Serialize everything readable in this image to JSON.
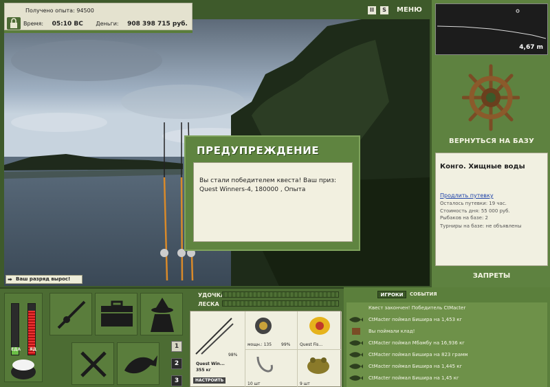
{
  "info": {
    "experience_label": "Получено опыта:",
    "experience_value": "94500",
    "time_label": "Время:",
    "time_value": "05:10 ВС",
    "money_label": "Деньги:",
    "money_value": "908 398 715 руб."
  },
  "topbar": {
    "pause": "II",
    "speed": "S",
    "menu": "МЕНЮ"
  },
  "depth": {
    "value": "4,67 m"
  },
  "base": {
    "return_label": "ВЕРНУТЬСЯ НА БАЗУ",
    "location": "Конго. Хищные воды",
    "extend_link": "Продлить путевку",
    "lines": [
      "Осталось путевки: 19 час.",
      "Стоимость дня: 55 000 руб.",
      "Рыбаков на базе: 2",
      "Турниры на базе: не объявлены"
    ],
    "bans_label": "ЗАПРЕТЫ"
  },
  "toast": "Ваш разряд вырос!",
  "modal": {
    "title": "ПРЕДУПРЕЖДЕНИЕ",
    "message": "Вы стали победителем квеста! Ваш приз: Quest Winners-4, 180000 , Опыта"
  },
  "meters": {
    "food_label": "ЕДА",
    "poison_label": "ЯД",
    "food_level": 0.15,
    "poison_level": 0.85
  },
  "hotbar": {
    "buttons": [
      "1",
      "2",
      "3"
    ],
    "selected": "2"
  },
  "tackle": {
    "rod_label": "УДОЧКА",
    "line_label": "ЛЕСКА",
    "rod_name": "Quest Win...",
    "rod_weight": "355 кг",
    "rod_percent": "98%",
    "reel_label": "мощн.: 135",
    "reel_percent": "99%",
    "lure_label": "Quest Fis...",
    "hook_count": "10 шт",
    "bait_count": "9 шт",
    "setup_label": "НАСТРОИТЬ"
  },
  "events": {
    "tabs": [
      "ИГРОКИ",
      "СОБЫТИЯ"
    ],
    "active_tab": "ИГРОКИ",
    "items": [
      {
        "icon": "none",
        "text": "Квест закончен! Победитель CtMacter"
      },
      {
        "icon": "fish",
        "text": "CtMacter поймал Бишира на 1,453 кг"
      },
      {
        "icon": "chest",
        "text": "Вы поймали клад!"
      },
      {
        "icon": "fish",
        "text": "CtMacter поймал Мбамбу на 16,936 кг"
      },
      {
        "icon": "fish",
        "text": "CtMacter поймал Бишира на 823 грамм"
      },
      {
        "icon": "fish",
        "text": "CtMacter поймал Бишира на 1,445 кг"
      },
      {
        "icon": "fish",
        "text": "CtMacter поймал Бишира на 1,45 кг"
      }
    ]
  },
  "colors": {
    "panel_green": "#5e8240",
    "dark_green": "#3e5a2b",
    "cream": "#f2f0e0",
    "link_blue": "#1a3fa8"
  }
}
